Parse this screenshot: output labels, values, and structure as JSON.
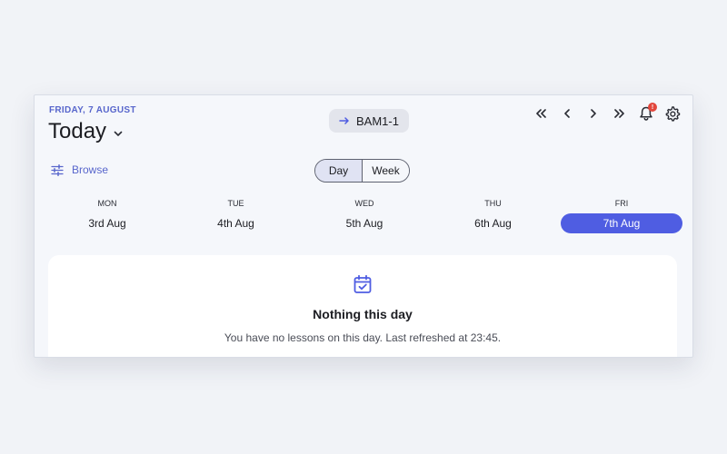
{
  "header": {
    "date_label": "FRIDAY, 7 AUGUST",
    "title": "Today"
  },
  "group_chip": {
    "label": "BAM1-1"
  },
  "toolbar": {
    "notification_count": "!"
  },
  "browse": {
    "label": "Browse"
  },
  "view_toggle": {
    "day": "Day",
    "week": "Week",
    "selected": "Day"
  },
  "days": [
    {
      "name": "MON",
      "date": "3rd Aug"
    },
    {
      "name": "TUE",
      "date": "4th Aug"
    },
    {
      "name": "WED",
      "date": "5th Aug"
    },
    {
      "name": "THU",
      "date": "6th Aug"
    },
    {
      "name": "FRI",
      "date": "7th Aug"
    }
  ],
  "selected_day": "FRI",
  "empty_state": {
    "title": "Nothing this day",
    "message": "You have no lessons on this day. Last refreshed at 23:45."
  },
  "colors": {
    "accent": "#4f5de2",
    "accent_text": "#5866cc",
    "badge": "#e2473d"
  }
}
